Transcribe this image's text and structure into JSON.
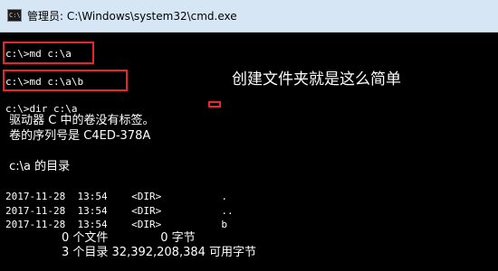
{
  "window": {
    "title": "管理员: C:\\Windows\\system32\\cmd.exe",
    "icon": "cmd-icon",
    "icon_text": "C:\\"
  },
  "console": {
    "lines": [
      "c:\\>md c:\\a",
      "c:\\>md c:\\a\\b",
      "c:\\>dir c:\\a",
      " 驱动器 C 中的卷没有标签。",
      " 卷的序列号是 C4ED-378A",
      " c:\\a 的目录",
      "2017-11-28  13:54    <DIR>          .",
      "2017-11-28  13:54    <DIR>          ..",
      "2017-11-28  13:54    <DIR>          b",
      "               0 个文件              0 字节",
      "               3 个目录 32,392,208,384 可用字节"
    ]
  },
  "annotation": {
    "text": "创建文件夹就是这么简单"
  },
  "colors": {
    "highlight": "#e8262b",
    "titlebar": "#d6e6f4",
    "console_bg": "#000000",
    "console_fg": "#ffffff"
  }
}
